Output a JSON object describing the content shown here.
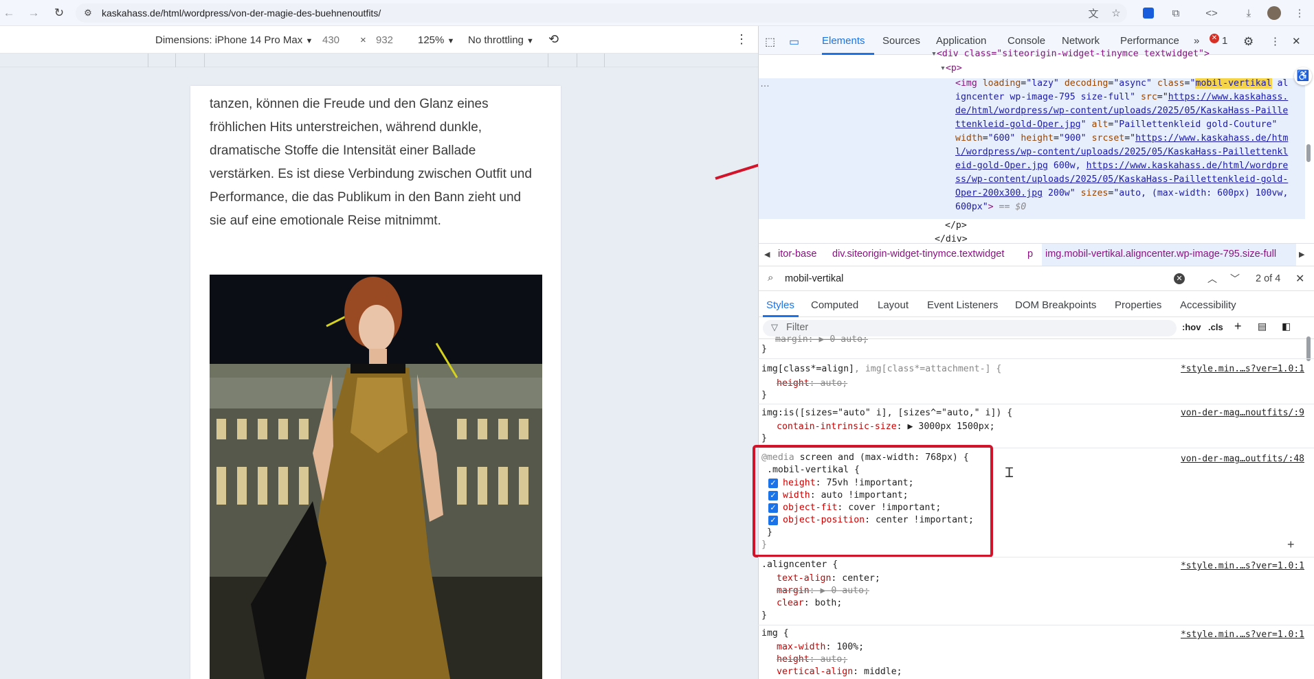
{
  "browser": {
    "url": "kaskahass.de/html/wordpress/von-der-magie-des-buehnenoutfits/"
  },
  "device_toolbar": {
    "dimensions_label": "Dimensions: iPhone 14 Pro Max",
    "width": "430",
    "times": "×",
    "height": "932",
    "zoom": "125%",
    "throttling": "No throttling"
  },
  "article": {
    "paragraph": "tanzen, können die Freude und den Glanz eines fröhlichen Hits unterstreichen, während dunkle, dramatische Stoffe die Intensität einer Ballade verstärken. Es ist diese Verbindung zwischen Outfit und Performance, die das Publikum in den Bann zieht und sie auf eine emotionale Reise mitnimmt."
  },
  "devtools": {
    "tabs": [
      "Elements",
      "Sources",
      "Application",
      "Console",
      "Network",
      "Performance"
    ],
    "more_tabs": "»",
    "error_count": "1",
    "dom": {
      "line1_tag": "<div class=\"siteorigin-widget-tinymce textwidget\">",
      "line2_tag": "<p>",
      "img_open": "<img ",
      "img_attr1_name": "loading",
      "img_attr1_val": "\"lazy\"",
      "img_attr2_name": "decoding",
      "img_attr2_val": "\"async\"",
      "img_attr3_name": "class",
      "class_highlight": "mobil-vertikal",
      "class_rest_1": " al",
      "class_rest_2": "igncenter wp-image-795 size-full\"",
      "src_name": "src",
      "src_1": "https://www.kaskahass.",
      "src_2": "de/html/wordpress/wp-content/uploads/2025/05/KaskaHass-Paille",
      "src_3": "ttenkleid-gold-Oper.jpg",
      "alt_name": "alt",
      "alt_val": "\"Paillettenkleid gold-Couture\"",
      "width_name": "width",
      "width_val": "\"600\"",
      "height_name": "height",
      "height_val": "\"900\"",
      "srcset_name": "srcset",
      "srcset_1": "https://www.kaskahass.de/htm",
      "srcset_2": "l/wordpress/wp-content/uploads/2025/05/KaskaHass-Paillettenkl",
      "srcset_3": "eid-gold-Oper.jpg",
      "srcset_3b": " 600w, ",
      "srcset_3c": "https://www.kaskahass.de/html/wordpre",
      "srcset_4": "ss/wp-content/uploads/2025/05/KaskaHass-Paillettenkleid-gold-",
      "srcset_5": "Oper-200x300.jpg",
      "srcset_5b": " 200w",
      "sizes_name": "sizes",
      "sizes_val": "\"auto, (max-width: 600px) 100vw,",
      "sizes_val2": "600px\"",
      "eq_dollar": "== $0",
      "close_p": "</p>",
      "close_div": "</div>",
      "ellipsis": "…"
    },
    "breadcrumbs": [
      "itor-base",
      "div.siteorigin-widget-tinymce.textwidget",
      "p",
      "img.mobil-vertikal.aligncenter.wp-image-795.size-full"
    ],
    "search": {
      "query": "mobil-vertikal",
      "count": "2 of 4"
    },
    "style_tabs": [
      "Styles",
      "Computed",
      "Layout",
      "Event Listeners",
      "DOM Breakpoints",
      "Properties",
      "Accessibility"
    ],
    "filter_placeholder": "Filter",
    "hov": ":hov",
    "cls": ".cls",
    "rules": {
      "r0_margin": "margin: ▶ 0 auto;",
      "r1_selector_a": "img[class*=align]",
      "r1_selector_b": ", img[class*=attachment-] {",
      "r1_prop": "height",
      "r1_val": ": auto;",
      "r1_src": "*style.min.…s?ver=1.0:1",
      "r2_selector": "img:is([sizes=\"auto\" i], [sizes^=\"auto,\" i]) {",
      "r2_prop": "contain-intrinsic-size",
      "r2_val": ": ▶ 3000px 1500px;",
      "r2_src": "von-der-mag…noutfits/:9",
      "r3_media_kw": "@media",
      "r3_media": " screen and (max-width: 768px) {",
      "r3_selector": ".mobil-vertikal {",
      "r3_p1": "height",
      "r3_v1": ": 75vh !important;",
      "r3_p2": "width",
      "r3_v2": ": auto !important;",
      "r3_p3": "object-fit",
      "r3_v3": ": cover !important;",
      "r3_p4": "object-position",
      "r3_v4": ": center !important;",
      "r3_src": "von-der-mag…outfits/:48",
      "r4_selector": ".aligncenter {",
      "r4_p1": "text-align",
      "r4_v1": ": center;",
      "r4_p2": "margin",
      "r4_v2": ": ▶ 0 auto;",
      "r4_p3": "clear",
      "r4_v3": ": both;",
      "r4_src": "*style.min.…s?ver=1.0:1",
      "r5_selector": "img {",
      "r5_p1": "max-width",
      "r5_v1": ": 100%;",
      "r5_p2": "height",
      "r5_v2": ": auto;",
      "r5_p3": "vertical-align",
      "r5_v3": ": middle;",
      "r5_src": "*style.min.…s?ver=1.0:1",
      "close_brace": "}",
      "plus": "+"
    }
  },
  "colors": {
    "accent": "#1a73e8",
    "annotation_red": "#d2142b",
    "highlight": "#f6d44a"
  }
}
